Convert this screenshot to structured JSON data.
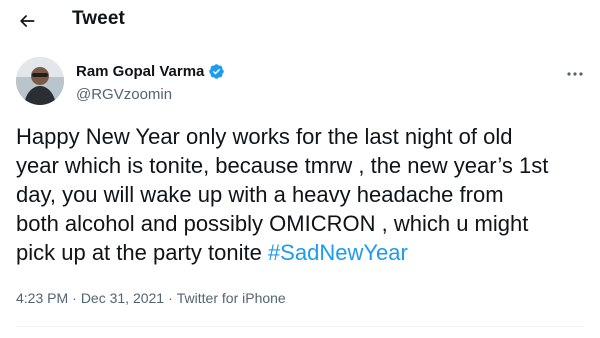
{
  "header": {
    "back_icon": "arrow-left-icon",
    "title": "Tweet"
  },
  "author": {
    "display_name": "Ram Gopal Varma",
    "handle": "@RGVzoomin",
    "verified_icon": "verified-badge-icon",
    "more_icon": "more-horizontal-icon"
  },
  "tweet": {
    "text": "Happy New Year only works for the last  night of old\nyear which is tonite, because tmrw , the new year’s 1st\nday,  you will wake up with a heavy headache from\nboth alcohol and possibly OMICRON ,  which u might\npick up at the party tonite ",
    "hashtag": "#SadNewYear"
  },
  "meta": {
    "time": "4:23 PM",
    "separator": "·",
    "date": "Dec 31, 2021",
    "source": "Twitter for iPhone"
  },
  "colors": {
    "accent": "#1d9bf0",
    "text": "#0f1419",
    "secondary": "#536471"
  }
}
